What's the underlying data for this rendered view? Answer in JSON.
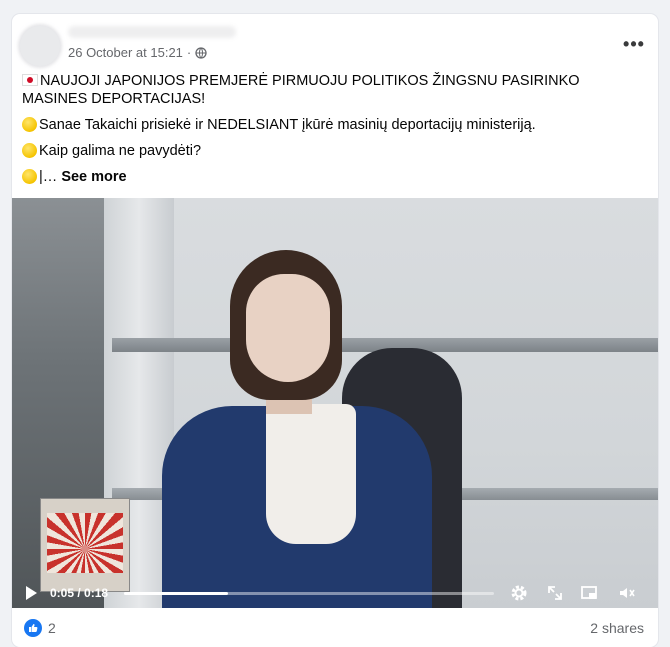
{
  "post": {
    "author_name": "",
    "timestamp": "26 October at 15:21",
    "separator": "·",
    "audience_icon": "globe-icon",
    "more_label": "•••",
    "lines": {
      "line1": "NAUJOJI JAPONIJOS PREMJERĖ PIRMUOJU POLITIKOS ŽINGSNU PASIRINKO MASINES DEPORTACIJAS!",
      "line2": "Sanae Takaichi prisiekė ir NEDELSIANT įkūrė masinių deportacijų ministeriją.",
      "line3": "Kaip galima ne pavydėti?",
      "line4_prefix": "|…",
      "see_more": "See more"
    }
  },
  "video": {
    "current_time": "0:05",
    "duration": "0:18",
    "time_display": "0:05 / 0:18",
    "progress_fraction": 0.28,
    "icons": [
      "play-icon",
      "settings-gear-icon",
      "fullscreen-icon",
      "picture-in-picture-icon",
      "mute-icon"
    ]
  },
  "footer": {
    "reaction_count": "2",
    "shares_label": "2 shares",
    "reaction_icon": "like-icon"
  },
  "colors": {
    "accent": "#1877f2",
    "secondary_text": "#65676b",
    "flag_red": "#d00c27"
  }
}
